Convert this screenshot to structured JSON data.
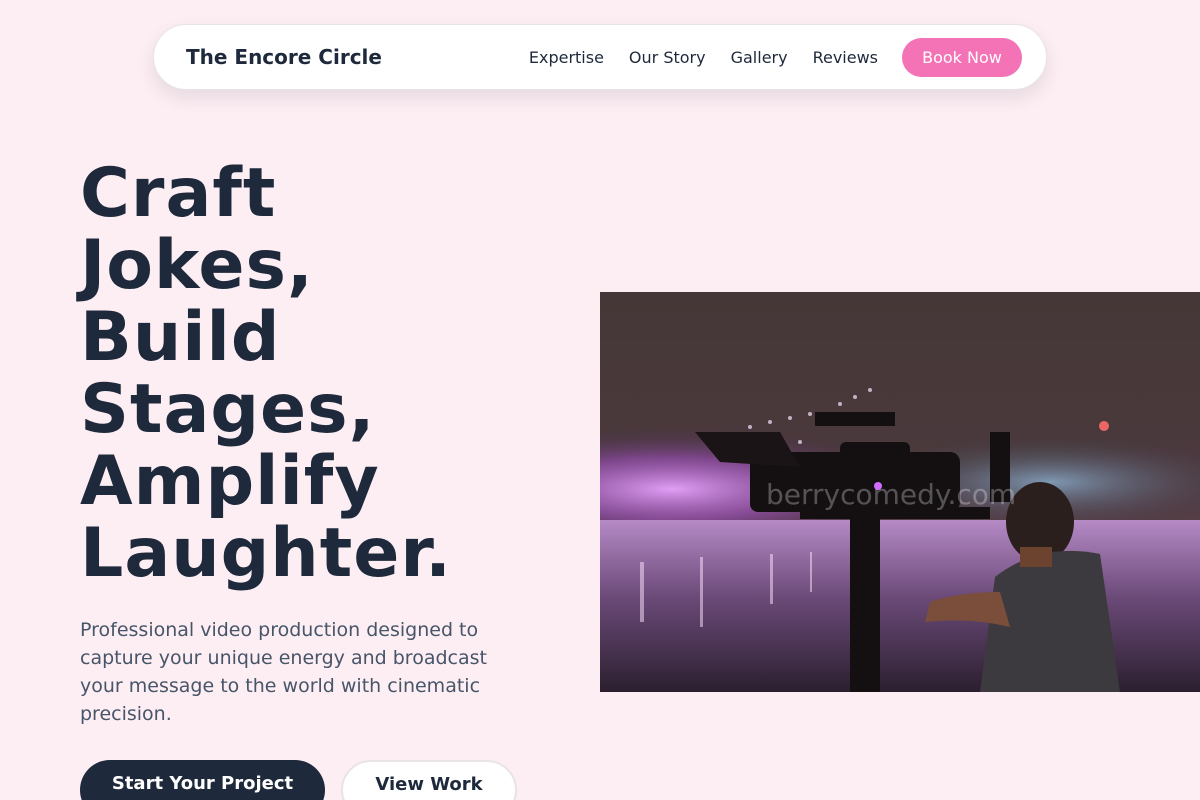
{
  "nav": {
    "brand": "The Encore Circle",
    "links": [
      "Expertise",
      "Our Story",
      "Gallery",
      "Reviews"
    ],
    "cta": "Book Now",
    "cta_color": "#f472b6"
  },
  "hero": {
    "title_lines": [
      "Craft",
      "Jokes,",
      "Build",
      "Stages,",
      "Amplify",
      "Laughter."
    ],
    "description": "Professional video production designed to capture your unique energy and broadcast your message to the world with cinematic precision.",
    "primary_cta": "Start Your Project",
    "secondary_cta": "View Work",
    "image": {
      "watermark": "berrycomedy.com"
    }
  },
  "colors": {
    "background": "#fdeef3",
    "text": "#1e293b",
    "muted": "#475569",
    "accent": "#f472b6"
  }
}
